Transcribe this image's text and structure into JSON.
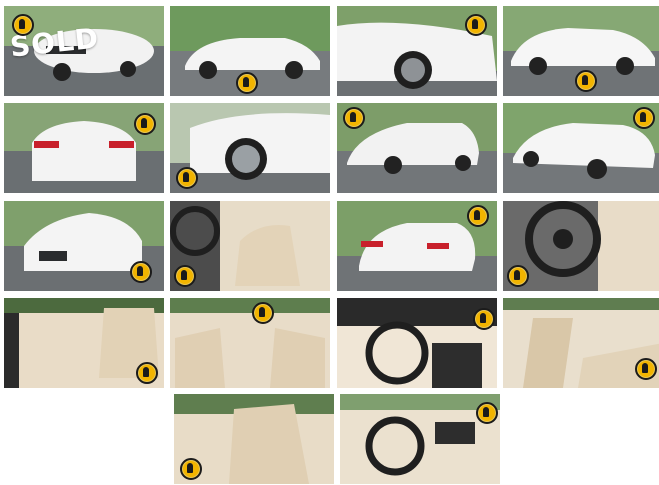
{
  "gallery": {
    "overlay_text": "SOLD",
    "badge_icon": "gold-brand-badge-icon",
    "badge_color": "#f2b400",
    "photos": [
      {
        "name": "photo-front-three-quarter"
      },
      {
        "name": "photo-side-left"
      },
      {
        "name": "photo-front-wheel-closeup"
      },
      {
        "name": "photo-side-right"
      },
      {
        "name": "photo-rear"
      },
      {
        "name": "photo-rear-wheel-closeup"
      },
      {
        "name": "photo-rear-three-quarter"
      },
      {
        "name": "photo-rear-three-quarter-right"
      },
      {
        "name": "photo-front"
      },
      {
        "name": "photo-interior-driver-seat"
      },
      {
        "name": "photo-rear-three-quarter-parked"
      },
      {
        "name": "photo-steering-wheel"
      },
      {
        "name": "photo-driver-door-interior"
      },
      {
        "name": "photo-rear-seats"
      },
      {
        "name": "photo-dashboard"
      },
      {
        "name": "photo-rear-seat-side"
      },
      {
        "name": "photo-front-seats-side"
      },
      {
        "name": "photo-cockpit"
      }
    ]
  }
}
